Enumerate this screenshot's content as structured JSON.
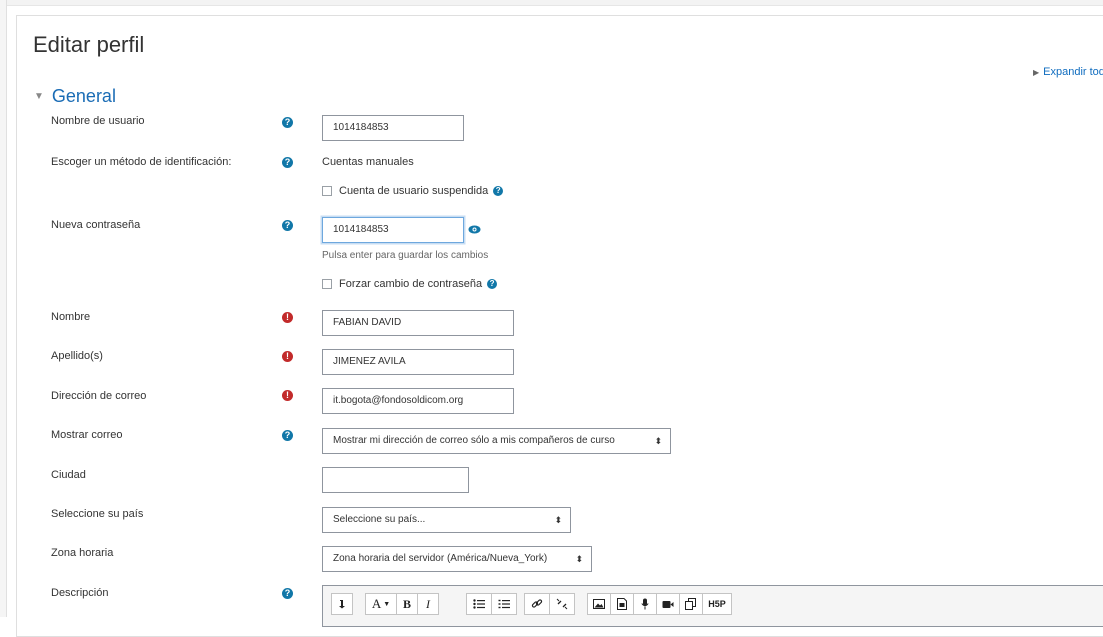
{
  "page_title": "Editar perfil",
  "expand_all": "Expandir todo",
  "section": {
    "label": "General"
  },
  "fields": {
    "username": {
      "label": "Nombre de usuario",
      "value": "1014184853"
    },
    "auth": {
      "label": "Escoger un método de identificación:",
      "value": "Cuentas manuales",
      "suspended_label": "Cuenta de usuario suspendida"
    },
    "new_password": {
      "label": "Nueva contraseña",
      "value": "1014184853",
      "hint": "Pulsa enter para guardar los cambios",
      "force_change_label": "Forzar cambio de contraseña"
    },
    "first_name": {
      "label": "Nombre",
      "value": "FABIAN DAVID"
    },
    "last_name": {
      "label": "Apellido(s)",
      "value": "JIMENEZ AVILA"
    },
    "email": {
      "label": "Dirección de correo",
      "value": "it.bogota@fondosoldicom.org"
    },
    "email_display": {
      "label": "Mostrar correo",
      "value": "Mostrar mi dirección de correo sólo a mis compañeros de curso"
    },
    "city": {
      "label": "Ciudad",
      "value": ""
    },
    "country": {
      "label": "Seleccione su país",
      "value": "Seleccione su país..."
    },
    "timezone": {
      "label": "Zona horaria",
      "value": "Zona horaria del servidor (América/Nueva_York)"
    },
    "description": {
      "label": "Descripción"
    }
  },
  "editor_toolbar": {
    "bold": "B",
    "italic": "I",
    "font_a": "A",
    "h5p": "H5P"
  },
  "colors": {
    "link": "#1a6cb5",
    "help": "#1177a8",
    "required": "#c22a2a"
  }
}
